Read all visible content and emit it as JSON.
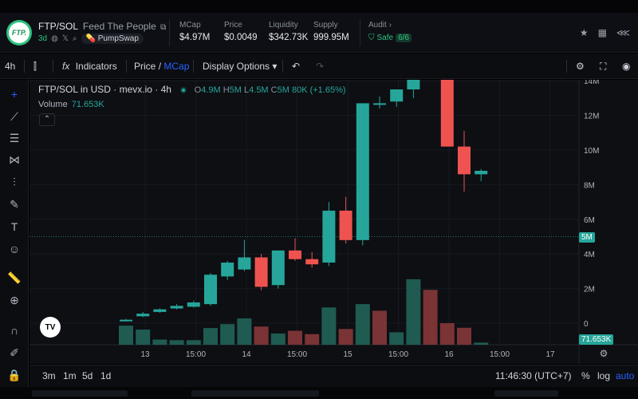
{
  "header": {
    "pair": "FTP/SOL",
    "full_name": "Feed The People",
    "logo_text": "FTP.",
    "age": "3d",
    "dex": "PumpSwap",
    "stats": [
      {
        "label": "MCap",
        "value": "$4.97M"
      },
      {
        "label": "Price",
        "value": "$0.0049"
      },
      {
        "label": "Liquidity",
        "value": "$342.73K"
      },
      {
        "label": "Supply",
        "value": "999.95M"
      }
    ],
    "audit": {
      "label": "Audit",
      "status": "Safe",
      "score": "6/6"
    }
  },
  "toolbar": {
    "interval": "4h",
    "indicators": "Indicators",
    "price_label": "Price",
    "slash": "/",
    "mcap_label": "MCap",
    "display_options": "Display Options"
  },
  "legend": {
    "title": "FTP/SOL in USD · mevx.io · 4h",
    "o_label": "O",
    "o": "4.9M",
    "h_label": "H",
    "h": "5M",
    "l_label": "L",
    "l": "4.5M",
    "c_label": "C",
    "c": "5M",
    "change": "80K (+1.65%)",
    "volume_label": "Volume",
    "volume_value": "71.653K"
  },
  "tv_logo": "TV",
  "price_axis": {
    "current_price_tag": "5M",
    "volume_tag": "71.653K"
  },
  "bottom": {
    "ranges": [
      "3m",
      "1m",
      "5d",
      "1d"
    ],
    "clock": "11:46:30 (UTC+7)",
    "percent": "%",
    "log": "log",
    "auto": "auto"
  },
  "colors": {
    "up": "#26a69a",
    "down": "#ef5350",
    "accent": "#2962ff"
  },
  "chart_data": {
    "type": "candlestick",
    "title": "FTP/SOL in USD · mevx.io · 4h",
    "x_tick_labels": [
      "13",
      "15:00",
      "14",
      "15:00",
      "15",
      "15:00",
      "16",
      "15:00",
      "17"
    ],
    "y_tick_labels": [
      "14M",
      "12M",
      "10M",
      "8M",
      "6M",
      "4M",
      "2M",
      "0"
    ],
    "ylim": [
      0,
      14
    ],
    "y_unit": "M",
    "current_price": 5,
    "grid": true,
    "candles": [
      {
        "o": 0.15,
        "h": 0.25,
        "l": 0.1,
        "c": 0.2
      },
      {
        "o": 0.4,
        "h": 0.65,
        "l": 0.35,
        "c": 0.55
      },
      {
        "o": 0.65,
        "h": 0.85,
        "l": 0.6,
        "c": 0.8
      },
      {
        "o": 0.85,
        "h": 1.1,
        "l": 0.8,
        "c": 1.0
      },
      {
        "o": 0.95,
        "h": 1.3,
        "l": 0.9,
        "c": 1.2
      },
      {
        "o": 1.1,
        "h": 2.9,
        "l": 1.0,
        "c": 2.8
      },
      {
        "o": 2.7,
        "h": 3.6,
        "l": 2.5,
        "c": 3.5
      },
      {
        "o": 3.1,
        "h": 4.8,
        "l": 3.0,
        "c": 3.8
      },
      {
        "o": 3.8,
        "h": 4.0,
        "l": 1.9,
        "c": 2.1
      },
      {
        "o": 2.2,
        "h": 4.2,
        "l": 2.0,
        "c": 4.2
      },
      {
        "o": 4.2,
        "h": 4.9,
        "l": 3.6,
        "c": 3.7
      },
      {
        "o": 3.7,
        "h": 4.1,
        "l": 3.2,
        "c": 3.4
      },
      {
        "o": 3.5,
        "h": 7.0,
        "l": 3.3,
        "c": 6.5
      },
      {
        "o": 6.5,
        "h": 7.3,
        "l": 4.6,
        "c": 4.8
      },
      {
        "o": 4.8,
        "h": 10.0,
        "l": 4.5,
        "c": 12.7
      },
      {
        "o": 12.7,
        "h": 13.1,
        "l": 12.4,
        "c": 12.7
      },
      {
        "o": 12.8,
        "h": 13.4,
        "l": 12.5,
        "c": 13.5
      },
      {
        "o": 13.5,
        "h": 16.8,
        "l": 13.0,
        "c": 16.4
      },
      {
        "o": 16.4,
        "h": 17.7,
        "l": 14.9,
        "c": 15.5
      },
      {
        "o": 15.5,
        "h": 15.8,
        "l": 10.2,
        "c": 10.2
      },
      {
        "o": 10.2,
        "h": 11.1,
        "l": 7.6,
        "c": 8.6
      },
      {
        "o": 8.6,
        "h": 8.9,
        "l": 8.2,
        "c": 8.8
      }
    ],
    "volume": [
      {
        "v": 0.63,
        "dir": "up"
      },
      {
        "v": 0.5,
        "dir": "up"
      },
      {
        "v": 0.17,
        "dir": "up"
      },
      {
        "v": 0.15,
        "dir": "up"
      },
      {
        "v": 0.15,
        "dir": "up"
      },
      {
        "v": 0.55,
        "dir": "up"
      },
      {
        "v": 0.68,
        "dir": "up"
      },
      {
        "v": 0.87,
        "dir": "up"
      },
      {
        "v": 0.6,
        "dir": "down"
      },
      {
        "v": 0.37,
        "dir": "up"
      },
      {
        "v": 0.46,
        "dir": "down"
      },
      {
        "v": 0.35,
        "dir": "down"
      },
      {
        "v": 1.23,
        "dir": "up"
      },
      {
        "v": 0.52,
        "dir": "down"
      },
      {
        "v": 1.34,
        "dir": "up"
      },
      {
        "v": 1.12,
        "dir": "down"
      },
      {
        "v": 0.41,
        "dir": "up"
      },
      {
        "v": 2.16,
        "dir": "up"
      },
      {
        "v": 1.81,
        "dir": "down"
      },
      {
        "v": 0.71,
        "dir": "down"
      },
      {
        "v": 0.56,
        "dir": "down"
      },
      {
        "v": 0.07,
        "dir": "up"
      }
    ]
  }
}
